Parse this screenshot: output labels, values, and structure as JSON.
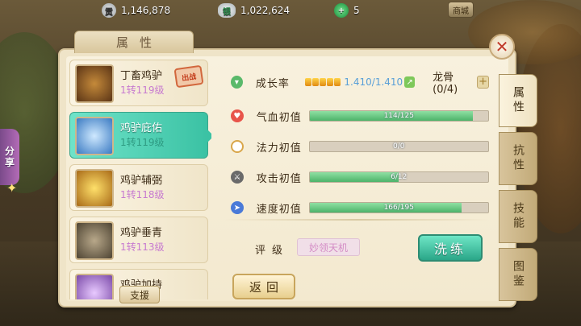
{
  "topbar": {
    "resources": [
      {
        "icon": "coin-icon",
        "icon_text": "贡",
        "value": "1,146,878"
      },
      {
        "icon": "silver-icon",
        "icon_text": "银",
        "value": "1,022,624"
      },
      {
        "icon": "jade-icon",
        "icon_text": "+",
        "value": "5"
      }
    ],
    "button_text": "商城"
  },
  "share": {
    "label_1": "分",
    "label_2": "享"
  },
  "panel": {
    "title": "属性"
  },
  "pets": [
    {
      "name": "丁畜鸡驴",
      "level": "1转119级",
      "stamp": "出战",
      "selected": false
    },
    {
      "name": "鸡驴庇佑",
      "level": "1转119级",
      "selected": true
    },
    {
      "name": "鸡驴辅弼",
      "level": "1转118级",
      "selected": false
    },
    {
      "name": "鸡驴垂青",
      "level": "1转113级",
      "selected": false
    },
    {
      "name": "鸡驴加持",
      "level": "",
      "selected": false
    }
  ],
  "support_button": "支援",
  "attributes": {
    "growth": {
      "label": "成长率",
      "value": "1.410/1.410",
      "stars": 5,
      "dragon_label": "龙骨(0/4)"
    },
    "rows": [
      {
        "label": "气血初值",
        "current": 114,
        "max": 125,
        "text": "114/125",
        "icon": "heart-icon",
        "color": "#e8544a"
      },
      {
        "label": "法力初值",
        "current": 0,
        "max": 0,
        "text": "0/0",
        "icon": "mana-icon",
        "color": "#d9a64a"
      },
      {
        "label": "攻击初值",
        "current": 6,
        "max": 12,
        "text": "6/12",
        "icon": "sword-icon",
        "color": "#7a7a7a"
      },
      {
        "label": "速度初值",
        "current": 166,
        "max": 195,
        "text": "166/195",
        "icon": "speed-icon",
        "color": "#4a7ad8"
      }
    ]
  },
  "rating": {
    "label": "评级",
    "value": "妙领天机"
  },
  "wash_button": "洗练",
  "back_button": "返回",
  "tabs": [
    "属性",
    "抗性",
    "技能",
    "图鉴"
  ],
  "colors": {
    "accent": "#3bc2a4",
    "panel": "#f3e9cf",
    "bar_fill": "#4db36a"
  }
}
